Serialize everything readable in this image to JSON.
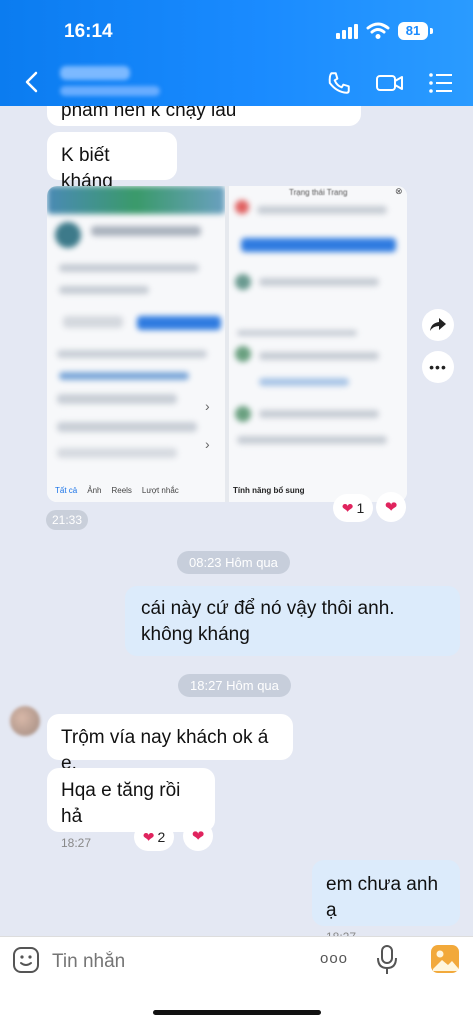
{
  "status": {
    "time": "16:14",
    "battery": "81"
  },
  "messages": [
    {
      "id": "m0",
      "text": "phẩm nên k chạy lâu"
    },
    {
      "id": "m1",
      "text": "K biết kháng"
    },
    {
      "id": "img",
      "left_items": [
        "Tất cả",
        "Ảnh",
        "Reels",
        "Lượt nhắc"
      ],
      "right_title": "Trạng thái Trang",
      "right_section": "Tính năng bổ sung",
      "time": "21:33",
      "reaction_count": "1"
    },
    {
      "id": "m2",
      "text": "cái này cứ để nó vậy thôi anh. không kháng"
    },
    {
      "id": "m3",
      "text": "Trộm vía nay khách ok á e."
    },
    {
      "id": "m4",
      "text": "Hqa e tăng rồi hả",
      "time": "18:27",
      "reaction_count": "2"
    },
    {
      "id": "m5",
      "text": "em chưa anh ạ",
      "time": "18:27"
    }
  ],
  "separators": [
    "08:23 Hôm qua",
    "18:27 Hôm qua"
  ],
  "composer": {
    "placeholder": "Tin nhắn"
  }
}
